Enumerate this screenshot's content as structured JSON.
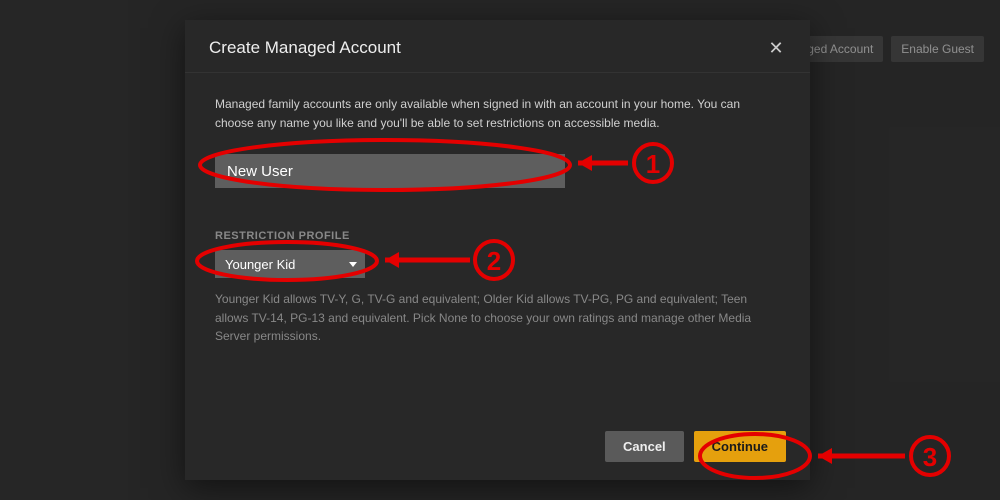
{
  "background": {
    "managed_account_button": "Managed Account",
    "enable_guest_button": "Enable Guest"
  },
  "modal": {
    "title": "Create Managed Account",
    "description": "Managed family accounts are only available when signed in with an account in your home. You can choose any name you like and you'll be able to set restrictions on accessible media.",
    "name_input_value": "New User",
    "restriction_label": "RESTRICTION PROFILE",
    "restriction_selected": "Younger Kid",
    "restriction_hint": "Younger Kid allows TV-Y, G, TV-G and equivalent; Older Kid allows TV-PG, PG and equivalent; Teen allows TV-14, PG-13 and equivalent. Pick None to choose your own ratings and manage other Media Server permissions.",
    "cancel_label": "Cancel",
    "continue_label": "Continue"
  },
  "annotations": {
    "step1": "1",
    "step2": "2",
    "step3": "3"
  }
}
